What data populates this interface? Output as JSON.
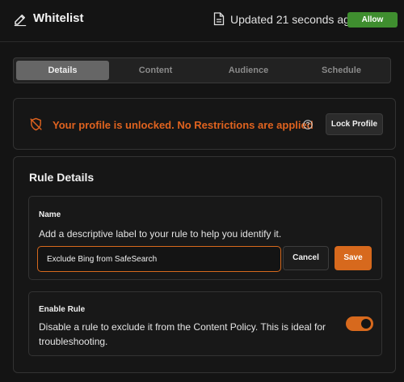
{
  "header": {
    "title": "Whitelist",
    "updated_text": "Updated 21 seconds ago",
    "status_badge": "Allow"
  },
  "tabs": [
    {
      "label": "Details",
      "active": true
    },
    {
      "label": "Content",
      "active": false
    },
    {
      "label": "Audience",
      "active": false
    },
    {
      "label": "Schedule",
      "active": false
    }
  ],
  "alert": {
    "message": "Your profile is unlocked.  No Restrictions are applied",
    "lock_button": "Lock Profile"
  },
  "rule_details": {
    "title": "Rule Details",
    "name": {
      "label": "Name",
      "description": "Add a descriptive label to your rule to help you identify it.",
      "value": "Exclude Bing from SafeSearch",
      "cancel_label": "Cancel",
      "save_label": "Save"
    },
    "enable": {
      "label": "Enable Rule",
      "description": "Disable a rule to exclude it from the Content Policy. This is ideal for troubleshooting.",
      "enabled": true
    }
  },
  "colors": {
    "accent": "#d7691d",
    "alert_text": "#e0631f",
    "allow_badge": "#3f8e2f",
    "background": "#141414"
  },
  "icons": [
    "pencil-icon",
    "document-icon",
    "shield-off-icon",
    "help-icon"
  ]
}
